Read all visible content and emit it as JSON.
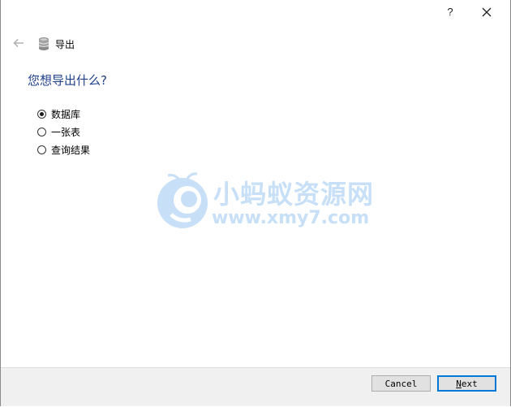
{
  "titlebar": {
    "help_label": "?",
    "close_icon": "close-icon"
  },
  "nav": {
    "back_icon": "arrow-left-icon",
    "db_icon": "database-icon",
    "title": "导出"
  },
  "question": "您想导出什么?",
  "options": [
    {
      "label": "数据库",
      "checked": true
    },
    {
      "label": "一张表",
      "checked": false
    },
    {
      "label": "查询结果",
      "checked": false
    }
  ],
  "watermark": {
    "title": "小蚂蚁资源网",
    "url": "www.xmy7.com"
  },
  "buttons": {
    "cancel": "Cancel",
    "next_mnemonic": "N",
    "next_rest": "ext"
  },
  "colors": {
    "question": "#1e3f8a",
    "watermark": "#c7dff7",
    "default_button_border": "#0078d7",
    "footer_bg": "#f0f0f0"
  }
}
